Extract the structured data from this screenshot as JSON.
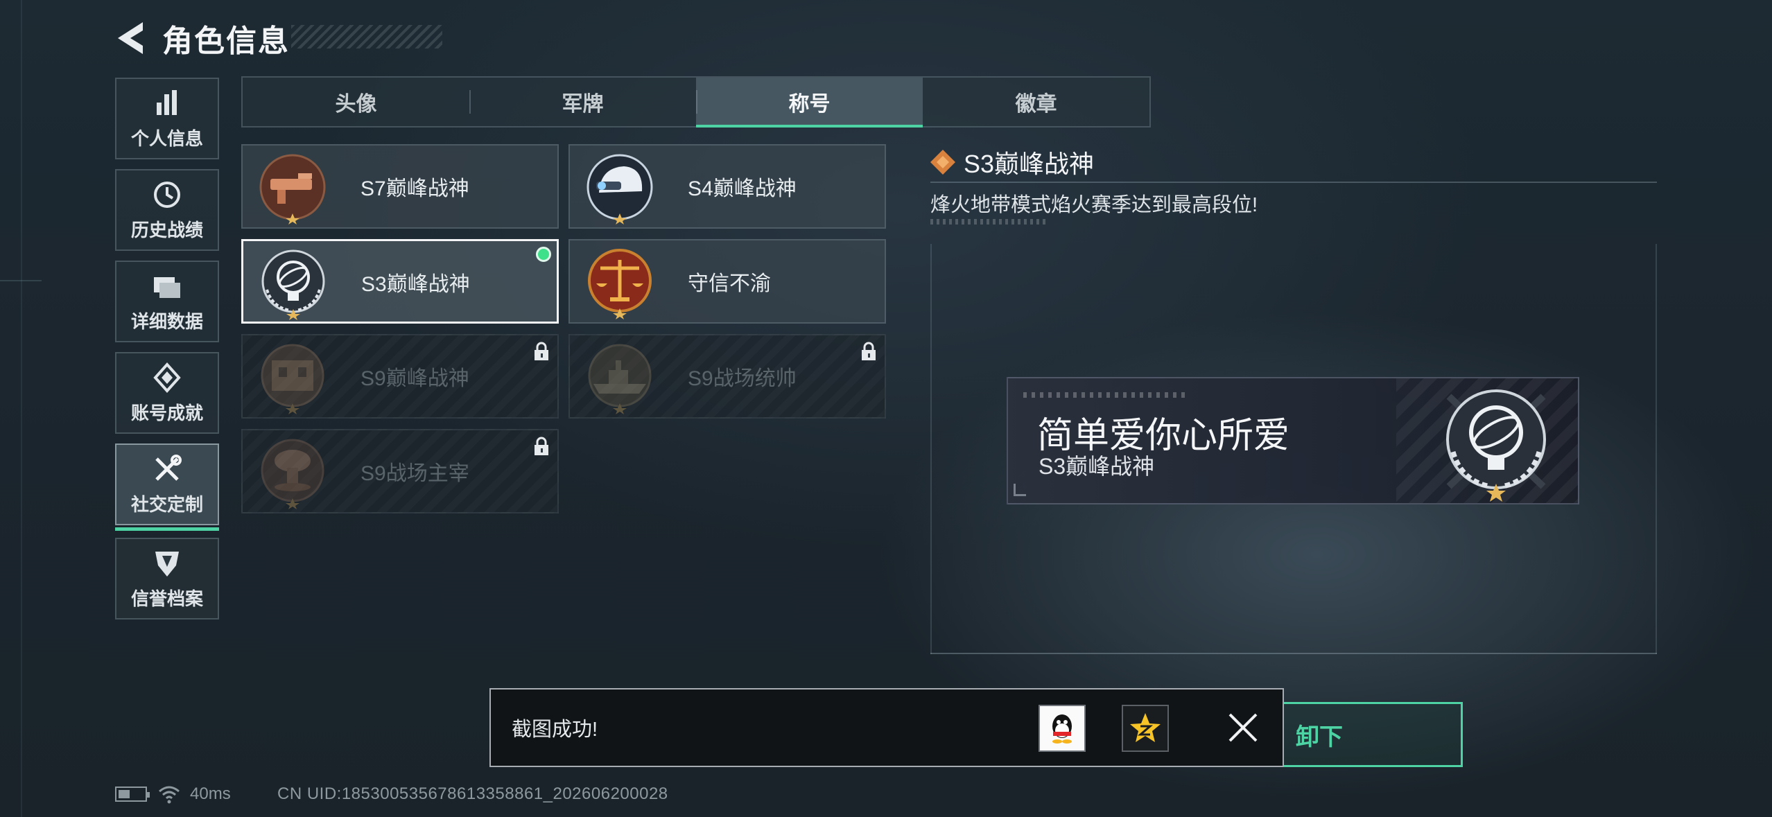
{
  "header": {
    "title": "角色信息"
  },
  "sidebar": {
    "items": [
      {
        "label": "个人信息",
        "icon": "bar-chart-icon",
        "active": false
      },
      {
        "label": "历史战绩",
        "icon": "clock-icon",
        "active": false
      },
      {
        "label": "详细数据",
        "icon": "folder-icon",
        "active": false
      },
      {
        "label": "账号成就",
        "icon": "medal-icon",
        "active": false
      },
      {
        "label": "社交定制",
        "icon": "tools-icon",
        "active": true
      },
      {
        "label": "信誉档案",
        "icon": "shield-icon",
        "active": false
      }
    ]
  },
  "tabs": [
    {
      "label": "头像",
      "active": false
    },
    {
      "label": "军牌",
      "active": false
    },
    {
      "label": "称号",
      "active": true
    },
    {
      "label": "徽章",
      "active": false
    }
  ],
  "titles": [
    {
      "name": "S7巅峰战神",
      "emblem": "s7-emblem-icon",
      "locked": false,
      "selected": false
    },
    {
      "name": "S4巅峰战神",
      "emblem": "s4-emblem-icon",
      "locked": false,
      "selected": false
    },
    {
      "name": "S3巅峰战神",
      "emblem": "s3-emblem-icon",
      "locked": false,
      "selected": true
    },
    {
      "name": "守信不渝",
      "emblem": "scales-emblem-icon",
      "locked": false,
      "selected": false
    },
    {
      "name": "S9巅峰战神",
      "emblem": "s9-emblem-icon",
      "locked": true,
      "selected": false
    },
    {
      "name": "S9战场统帅",
      "emblem": "warship-emblem-icon",
      "locked": true,
      "selected": false
    },
    {
      "name": "S9战场主宰",
      "emblem": "mushroom-cloud-emblem-icon",
      "locked": true,
      "selected": false
    }
  ],
  "detail": {
    "title": "S3巅峰战神",
    "description": "烽火地带模式焰火赛季达到最高段位!"
  },
  "nameplate": {
    "player_name": "简单爱你心所爱",
    "title": "S3巅峰战神"
  },
  "toast": {
    "message": "截图成功!",
    "share_targets": [
      "qq-icon",
      "qzone-icon"
    ]
  },
  "unequip_button": {
    "label": "卸下"
  },
  "status_bar": {
    "ping": "40ms",
    "uid": "CN UID:1853005356786133588​61_202606200028"
  },
  "colors": {
    "accent": "#4ed3a4",
    "selected_dot": "#3fe08a",
    "background": "#1d2a33"
  }
}
